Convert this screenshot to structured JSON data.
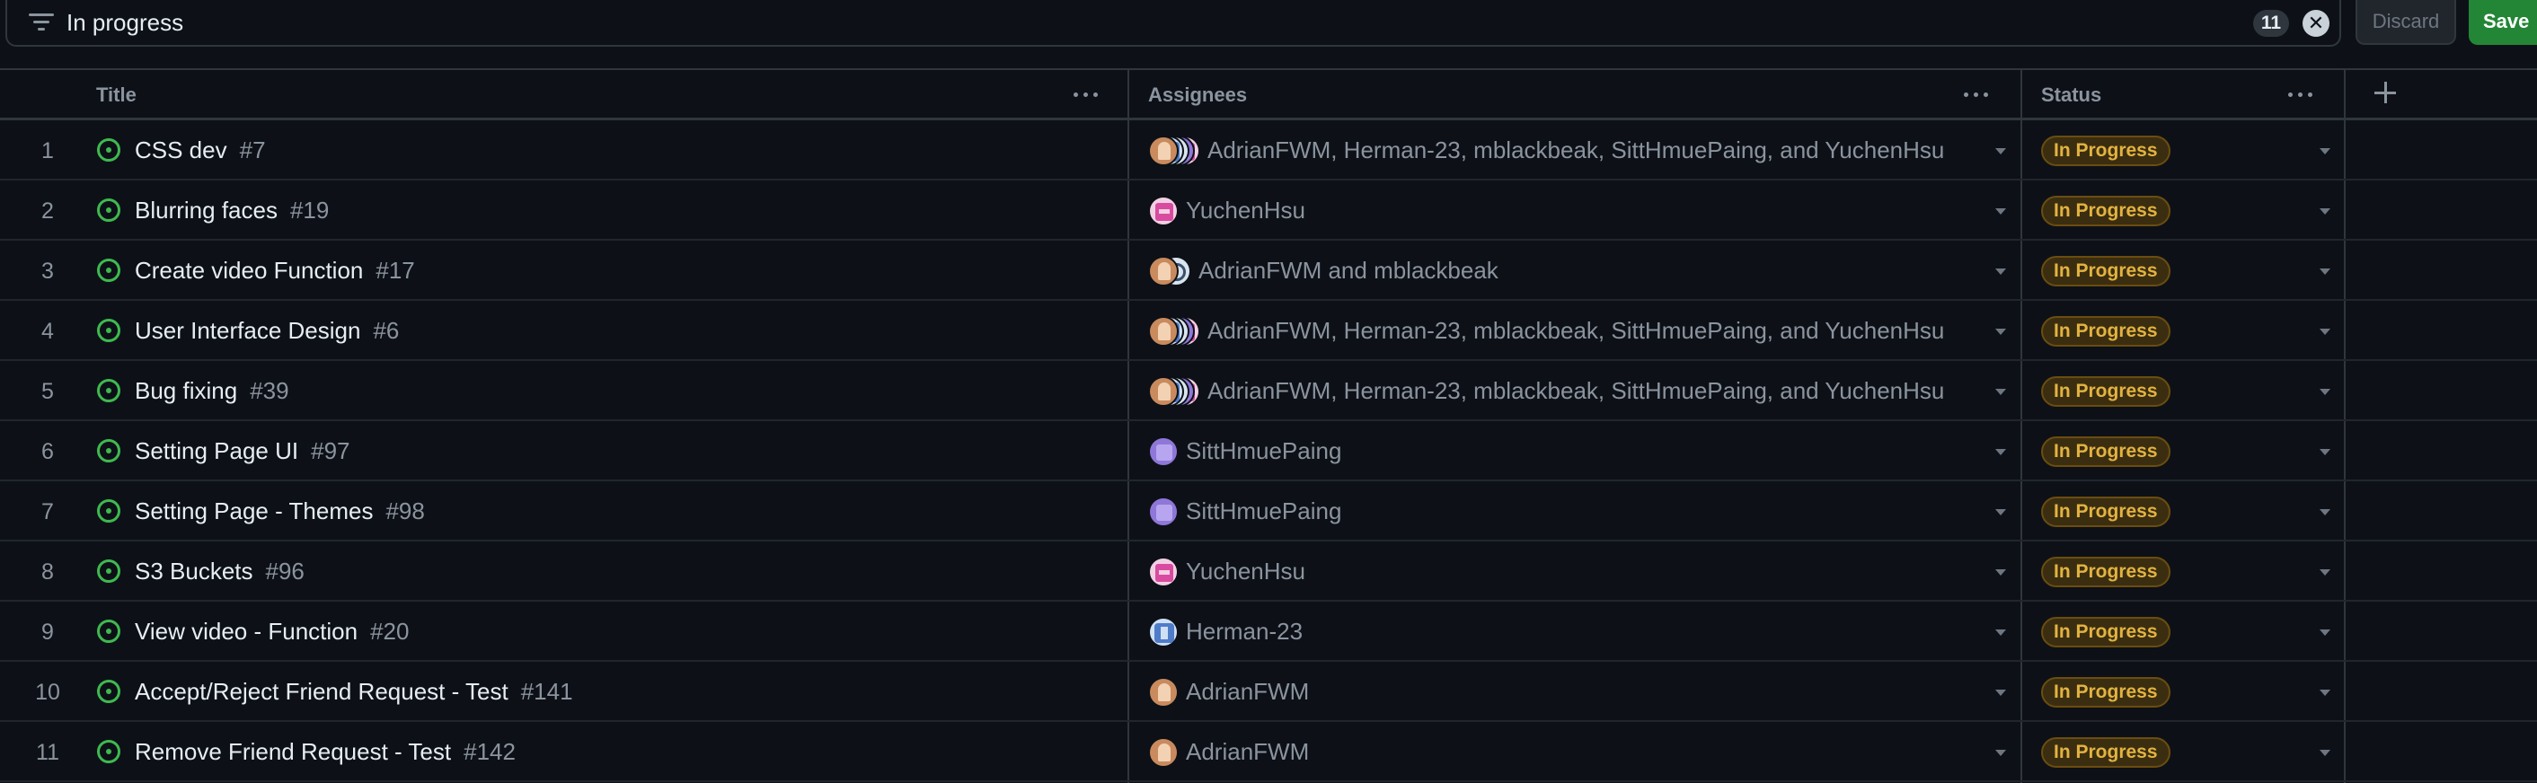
{
  "filter": {
    "query": "In progress",
    "count": "11",
    "clear_icon": "✕",
    "discard_label": "Discard",
    "save_label": "Save"
  },
  "columns": [
    {
      "label": "Title"
    },
    {
      "label": "Assignees"
    },
    {
      "label": "Status"
    }
  ],
  "add_column_icon": "plus-icon",
  "status_color": "#e3b341",
  "rows": [
    {
      "num": "1",
      "title": "CSS dev",
      "issue": "#7",
      "assignees": "AdrianFWM, Herman-23, mblackbeak, SittHmuePaing, and YuchenHsu",
      "avatars": [
        "adrian",
        "herman",
        "mblack",
        "sitt",
        "yuchen"
      ],
      "status": "In Progress"
    },
    {
      "num": "2",
      "title": "Blurring faces",
      "issue": "#19",
      "assignees": "YuchenHsu",
      "avatars": [
        "yuchen"
      ],
      "status": "In Progress"
    },
    {
      "num": "3",
      "title": "Create video Function",
      "issue": "#17",
      "assignees": "AdrianFWM and mblackbeak",
      "avatars": [
        "adrian",
        "mblack"
      ],
      "status": "In Progress"
    },
    {
      "num": "4",
      "title": "User Interface Design",
      "issue": "#6",
      "assignees": "AdrianFWM, Herman-23, mblackbeak, SittHmuePaing, and YuchenHsu",
      "avatars": [
        "adrian",
        "herman",
        "mblack",
        "sitt",
        "yuchen"
      ],
      "status": "In Progress"
    },
    {
      "num": "5",
      "title": "Bug fixing",
      "issue": "#39",
      "assignees": "AdrianFWM, Herman-23, mblackbeak, SittHmuePaing, and YuchenHsu",
      "avatars": [
        "adrian",
        "herman",
        "mblack",
        "sitt",
        "yuchen"
      ],
      "status": "In Progress"
    },
    {
      "num": "6",
      "title": "Setting Page UI",
      "issue": "#97",
      "assignees": "SittHmuePaing",
      "avatars": [
        "sitt"
      ],
      "status": "In Progress"
    },
    {
      "num": "7",
      "title": "Setting Page - Themes",
      "issue": "#98",
      "assignees": "SittHmuePaing",
      "avatars": [
        "sitt"
      ],
      "status": "In Progress"
    },
    {
      "num": "8",
      "title": "S3 Buckets",
      "issue": "#96",
      "assignees": "YuchenHsu",
      "avatars": [
        "yuchen"
      ],
      "status": "In Progress"
    },
    {
      "num": "9",
      "title": "View video - Function",
      "issue": "#20",
      "assignees": "Herman-23",
      "avatars": [
        "herman"
      ],
      "status": "In Progress"
    },
    {
      "num": "10",
      "title": "Accept/Reject Friend Request - Test",
      "issue": "#141",
      "assignees": "AdrianFWM",
      "avatars": [
        "adrian"
      ],
      "status": "In Progress"
    },
    {
      "num": "11",
      "title": "Remove Friend Request - Test",
      "issue": "#142",
      "assignees": "AdrianFWM",
      "avatars": [
        "adrian"
      ],
      "status": "In Progress"
    }
  ]
}
